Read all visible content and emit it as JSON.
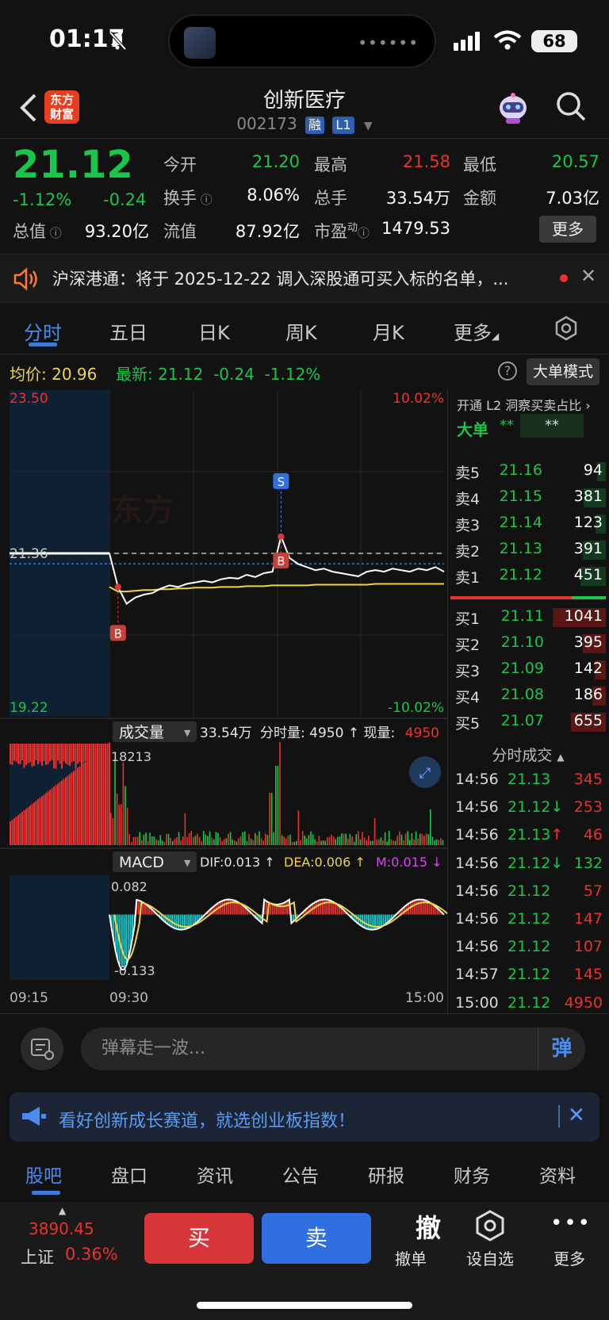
{
  "status": {
    "time": "01:17",
    "battery": "68"
  },
  "header": {
    "brand": "东方\n财富",
    "brand_line1": "东方",
    "brand_line2": "财富",
    "name": "创新医疗",
    "code": "002173",
    "badge1": "融",
    "badge2": "L1"
  },
  "quote": {
    "last": "21.12",
    "change_pct": "-1.12%",
    "change_val": "-0.24",
    "open_label": "今开",
    "open": "21.20",
    "high_label": "最高",
    "high": "21.58",
    "low_label": "最低",
    "low": "20.57",
    "turnover_label": "换手",
    "turnover": "8.06%",
    "volume_label": "总手",
    "volume": "33.54万",
    "amount_label": "金额",
    "amount": "7.03亿",
    "mktcap_label": "总值",
    "mktcap": "93.20亿",
    "float_label": "流值",
    "float": "87.92亿",
    "pe_label": "市盈",
    "pe_sup": "动",
    "pe": "1479.53",
    "more_label": "更多"
  },
  "news": {
    "text": "沪深港通：将于 2025-12-22 调入深股通可买入标的名单，..."
  },
  "chart_tabs": [
    "分时",
    "五日",
    "日K",
    "周K",
    "月K",
    "更多"
  ],
  "avg_row": {
    "avg_label": "均价:",
    "avg": "20.96",
    "latest_label": "最新:",
    "latest": "21.12",
    "chg": "-0.24",
    "pct": "-1.12%",
    "help": "?",
    "mode_button": "大单模式"
  },
  "chart_data": {
    "type": "line",
    "title": "",
    "price_axis": {
      "top": "23.50",
      "bottom": "19.22",
      "top_pct": "10.02%",
      "bottom_pct": "-10.02%",
      "ref": "21.36"
    },
    "x_ticks": [
      "09:15",
      "09:30",
      "15:00"
    ],
    "ylim": [
      19.22,
      23.5
    ],
    "prev_close": 21.36,
    "price_series": [
      21.36,
      20.92,
      20.7,
      20.78,
      20.82,
      20.84,
      20.9,
      20.94,
      20.92,
      20.96,
      20.98,
      21.0,
      20.98,
      21.02,
      21.04,
      21.03,
      21.08,
      21.05,
      21.1,
      21.12,
      21.58,
      21.3,
      21.22,
      21.18,
      21.14,
      21.16,
      21.12,
      21.1,
      21.08,
      21.06,
      21.12,
      21.14,
      21.12,
      21.16,
      21.14,
      21.12,
      21.16,
      21.14,
      21.18,
      21.12
    ],
    "avg_series": [
      20.92,
      20.86,
      20.86,
      20.87,
      20.88,
      20.88,
      20.89,
      20.89,
      20.9,
      20.9,
      20.91,
      20.91,
      20.91,
      20.92,
      20.92,
      20.92,
      20.93,
      20.93,
      20.93,
      20.94,
      20.94,
      20.94,
      20.94,
      20.94,
      20.95,
      20.95,
      20.95,
      20.95,
      20.95,
      20.95,
      20.95,
      20.96,
      20.96,
      20.96,
      20.96,
      20.96,
      20.96,
      20.96,
      20.96,
      20.96
    ],
    "markers": [
      {
        "label": "B",
        "kind": "buy",
        "index": 1
      },
      {
        "label": "S",
        "kind": "sell",
        "index": 20
      },
      {
        "label": "B",
        "kind": "buy",
        "index": 20
      }
    ],
    "volume": {
      "label": "成交量",
      "total": "33.54万",
      "minute_label": "分时量:",
      "minute": "4950",
      "now_label": "现量:",
      "now": "4950",
      "max_label": "18213",
      "max": 18213
    },
    "macd": {
      "label": "MACD",
      "dif_label": "DIF:",
      "dif": "0.013",
      "dea_label": "DEA:",
      "dea": "0.006",
      "m_label": "M:",
      "m": "0.015",
      "top": "0.082",
      "bottom": "-0.133",
      "ylim": [
        -0.133,
        0.082
      ]
    }
  },
  "orderbook": {
    "header": "开通 L2 洞察买卖占比",
    "big_label": "大单",
    "big_val1": "**",
    "big_val2": "**",
    "asks": [
      {
        "label": "卖5",
        "price": "21.16",
        "vol": "94"
      },
      {
        "label": "卖4",
        "price": "21.15",
        "vol": "381"
      },
      {
        "label": "卖3",
        "price": "21.14",
        "vol": "123"
      },
      {
        "label": "卖2",
        "price": "21.13",
        "vol": "391"
      },
      {
        "label": "卖1",
        "price": "21.12",
        "vol": "451"
      }
    ],
    "bids": [
      {
        "label": "买1",
        "price": "21.11",
        "vol": "1041"
      },
      {
        "label": "买2",
        "price": "21.10",
        "vol": "395"
      },
      {
        "label": "买3",
        "price": "21.09",
        "vol": "142"
      },
      {
        "label": "买4",
        "price": "21.08",
        "vol": "186"
      },
      {
        "label": "买5",
        "price": "21.07",
        "vol": "655"
      }
    ],
    "ticks_title": "分时成交",
    "ticks": [
      {
        "time": "14:56",
        "price": "21.13",
        "arrow": "",
        "vol": "345",
        "pc": "green",
        "vc": "red"
      },
      {
        "time": "14:56",
        "price": "21.12",
        "arrow": "↓",
        "vol": "253",
        "pc": "green",
        "vc": "red"
      },
      {
        "time": "14:56",
        "price": "21.13",
        "arrow": "↑",
        "vol": "46",
        "pc": "green",
        "vc": "red"
      },
      {
        "time": "14:56",
        "price": "21.12",
        "arrow": "↓",
        "vol": "132",
        "pc": "green",
        "vc": "green"
      },
      {
        "time": "14:56",
        "price": "21.12",
        "arrow": "",
        "vol": "57",
        "pc": "green",
        "vc": "red"
      },
      {
        "time": "14:56",
        "price": "21.12",
        "arrow": "",
        "vol": "147",
        "pc": "green",
        "vc": "red"
      },
      {
        "time": "14:56",
        "price": "21.12",
        "arrow": "",
        "vol": "107",
        "pc": "green",
        "vc": "red"
      },
      {
        "time": "14:57",
        "price": "21.12",
        "arrow": "",
        "vol": "145",
        "pc": "green",
        "vc": "red"
      },
      {
        "time": "15:00",
        "price": "21.12",
        "arrow": "",
        "vol": "4950",
        "pc": "green",
        "vc": "red"
      }
    ]
  },
  "danmu": {
    "placeholder": "弹幕走一波...",
    "send": "弹"
  },
  "ad": {
    "text": "看好创新成长赛道，就选创业板指数！"
  },
  "bottom_tabs": [
    "股吧",
    "盘口",
    "资讯",
    "公告",
    "研报",
    "财务",
    "资料"
  ],
  "action_bar": {
    "index_value": "3890.45",
    "index_name": "上证",
    "index_pct": "0.36%",
    "buy": "买",
    "sell": "卖",
    "cancel_glyph": "撤",
    "cancel": "撤单",
    "watch": "设自选",
    "more": "更多"
  },
  "colors": {
    "up": "#e9322e",
    "down": "#19c54b",
    "accent": "#3d7bd8",
    "avg": "#f2d447"
  }
}
